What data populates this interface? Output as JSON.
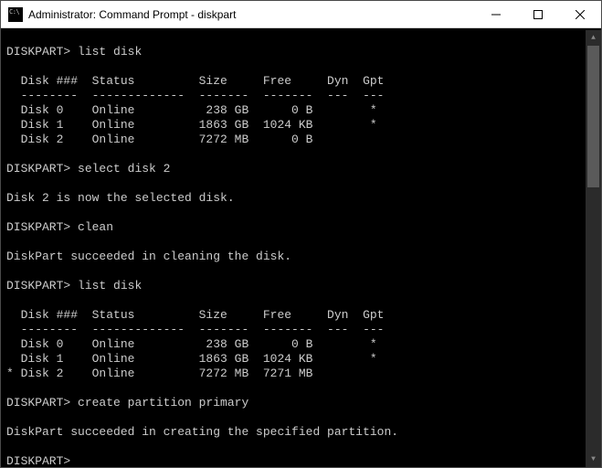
{
  "window": {
    "title": "Administrator: Command Prompt - diskpart"
  },
  "terminal": {
    "prompt": "DISKPART>",
    "cmd_list_disk": "list disk",
    "cmd_select": "select disk 2",
    "cmd_clean": "clean",
    "cmd_create": "create partition primary",
    "msg_selected": "Disk 2 is now the selected disk.",
    "msg_clean": "DiskPart succeeded in cleaning the disk.",
    "msg_create": "DiskPart succeeded in creating the specified partition.",
    "header_line": "  Disk ###  Status         Size     Free     Dyn  Gpt",
    "divider_line": "  --------  -------------  -------  -------  ---  ---",
    "table1": {
      "rows": [
        "  Disk 0    Online          238 GB      0 B        *",
        "  Disk 1    Online         1863 GB  1024 KB        *",
        "  Disk 2    Online         7272 MB      0 B"
      ]
    },
    "table2": {
      "rows": [
        "  Disk 0    Online          238 GB      0 B        *",
        "  Disk 1    Online         1863 GB  1024 KB        *",
        "* Disk 2    Online         7272 MB  7271 MB"
      ]
    }
  },
  "disk_data": [
    {
      "id": "Disk 0",
      "status": "Online",
      "size": "238 GB",
      "free": "0 B",
      "dyn": "",
      "gpt": "*"
    },
    {
      "id": "Disk 1",
      "status": "Online",
      "size": "1863 GB",
      "free": "1024 KB",
      "dyn": "",
      "gpt": "*"
    },
    {
      "id": "Disk 2",
      "status": "Online",
      "size": "7272 MB",
      "free": "0 B",
      "dyn": "",
      "gpt": ""
    }
  ],
  "disk_data_after_clean": [
    {
      "id": "Disk 0",
      "status": "Online",
      "size": "238 GB",
      "free": "0 B",
      "dyn": "",
      "gpt": "*",
      "selected": false
    },
    {
      "id": "Disk 1",
      "status": "Online",
      "size": "1863 GB",
      "free": "1024 KB",
      "dyn": "",
      "gpt": "*",
      "selected": false
    },
    {
      "id": "Disk 2",
      "status": "Online",
      "size": "7272 MB",
      "free": "7271 MB",
      "dyn": "",
      "gpt": "",
      "selected": true
    }
  ]
}
